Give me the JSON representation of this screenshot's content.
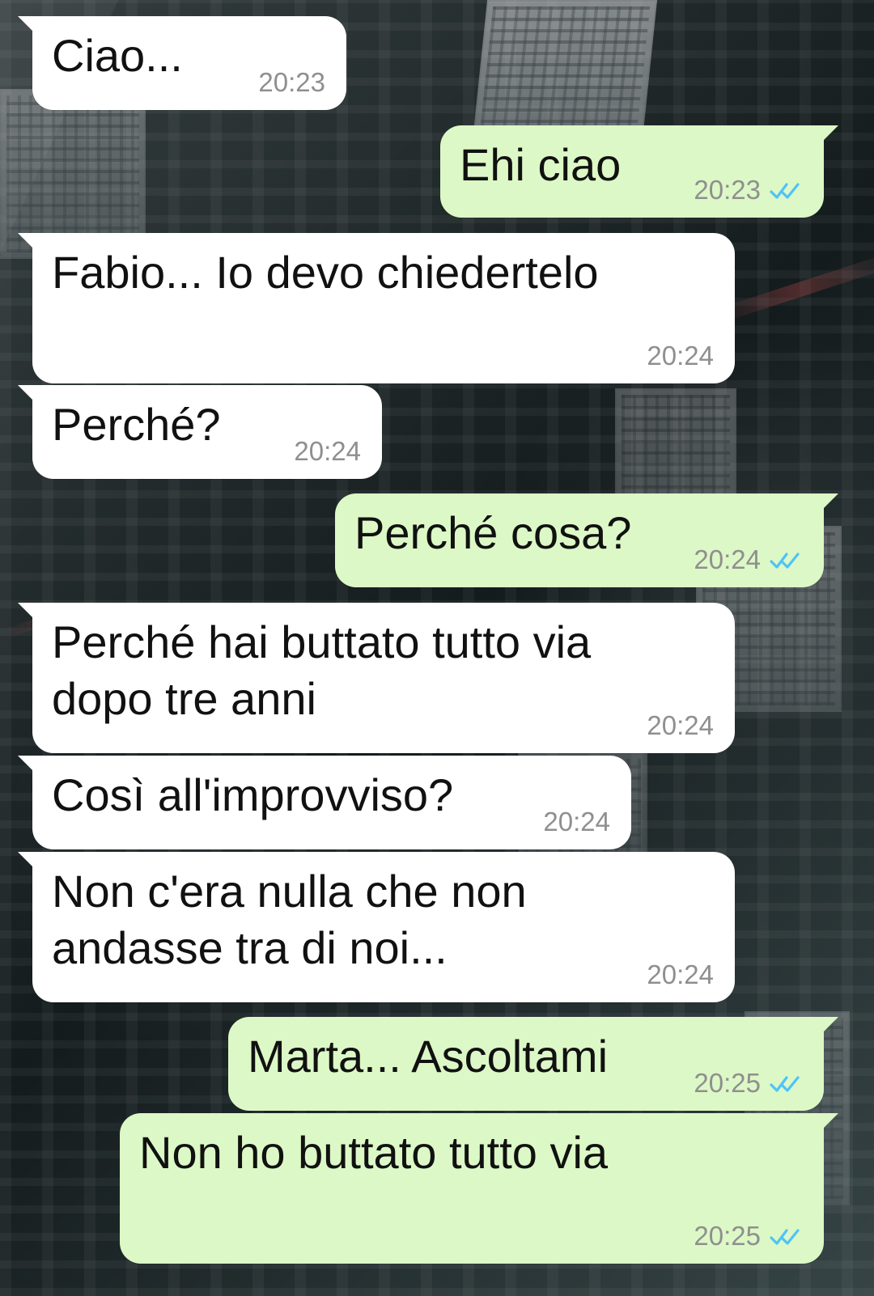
{
  "theme": {
    "incoming_bubble": "#ffffff",
    "outgoing_bubble": "#dcf8c6",
    "time_color": "#8f8f8f",
    "read_receipt": "#4fc3f7"
  },
  "messages": [
    {
      "side": "incoming",
      "text": "Ciao...",
      "time": "20:23"
    },
    {
      "side": "outgoing",
      "text": "Ehi ciao",
      "time": "20:23",
      "status": "read",
      "status_icon": "double-check-icon"
    },
    {
      "side": "incoming",
      "text": "Fabio... Io devo chiedertelo",
      "time": "20:24"
    },
    {
      "side": "incoming",
      "text": "Perché?",
      "time": "20:24"
    },
    {
      "side": "outgoing",
      "text": "Perché cosa?",
      "time": "20:24",
      "status": "read",
      "status_icon": "double-check-icon"
    },
    {
      "side": "incoming",
      "text": "Perché hai buttato tutto via\ndopo tre anni",
      "time": "20:24"
    },
    {
      "side": "incoming",
      "text": "Così all'improvviso?",
      "time": "20:24"
    },
    {
      "side": "incoming",
      "text": "Non c'era nulla che non\nandasse tra di noi...",
      "time": "20:24"
    },
    {
      "side": "outgoing",
      "text": "Marta... Ascoltami",
      "time": "20:25",
      "status": "read",
      "status_icon": "double-check-icon"
    },
    {
      "side": "outgoing",
      "text": "Non ho buttato tutto via",
      "time": "20:25",
      "status": "read",
      "status_icon": "double-check-icon"
    }
  ]
}
